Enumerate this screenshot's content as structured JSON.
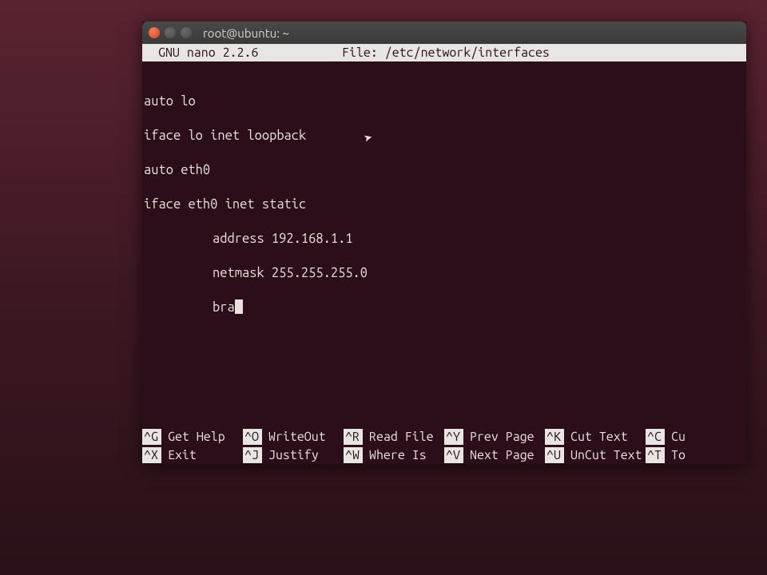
{
  "window": {
    "title": "root@ubuntu: ~"
  },
  "nano": {
    "header_left": "GNU nano 2.2.6",
    "header_file_label": "File:",
    "header_file_path": "/etc/network/interfaces"
  },
  "content": {
    "l1": "auto lo",
    "l2": "iface lo inet loopback",
    "l3": "auto eth0",
    "l4": "iface eth0 inet static",
    "l5": "address 192.168.1.1",
    "l6": "netmask 255.255.255.0",
    "l7": "bra"
  },
  "shortcuts": {
    "row1": [
      {
        "key": "^G",
        "label": "Get Help"
      },
      {
        "key": "^O",
        "label": "WriteOut"
      },
      {
        "key": "^R",
        "label": "Read File"
      },
      {
        "key": "^Y",
        "label": "Prev Page"
      },
      {
        "key": "^K",
        "label": "Cut Text"
      },
      {
        "key": "^C",
        "label": "Cu"
      }
    ],
    "row2": [
      {
        "key": "^X",
        "label": "Exit"
      },
      {
        "key": "^J",
        "label": "Justify"
      },
      {
        "key": "^W",
        "label": "Where Is"
      },
      {
        "key": "^V",
        "label": "Next Page"
      },
      {
        "key": "^U",
        "label": "UnCut Text"
      },
      {
        "key": "^T",
        "label": "To"
      }
    ]
  }
}
